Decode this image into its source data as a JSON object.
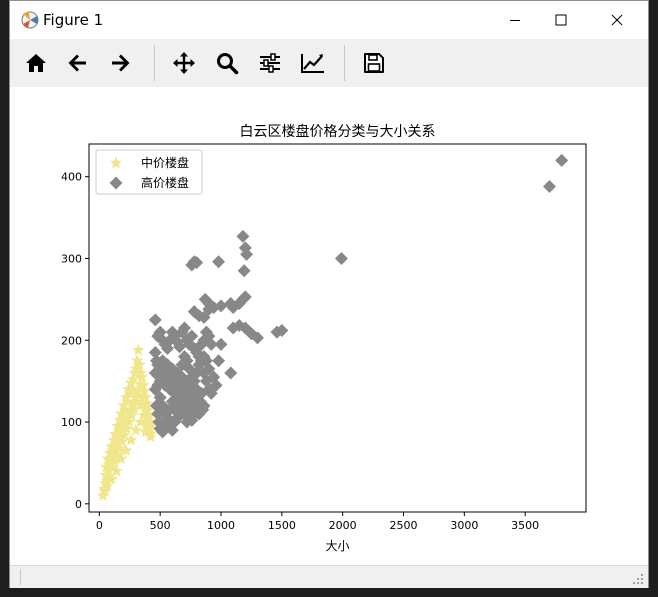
{
  "window": {
    "title": "Figure 1"
  },
  "toolbar": {
    "items": [
      {
        "icon": "home-icon"
      },
      {
        "icon": "back-arrow-icon"
      },
      {
        "icon": "forward-arrow-icon"
      },
      {
        "icon": "pan-move-icon"
      },
      {
        "icon": "zoom-magnifier-icon"
      },
      {
        "icon": "configure-subplots-icon"
      },
      {
        "icon": "edit-axis-icon"
      },
      {
        "icon": "save-floppy-icon"
      }
    ]
  },
  "colors": {
    "mid": "#f0e68c",
    "high": "#888888"
  },
  "chart_data": {
    "type": "scatter",
    "title": "白云区楼盘价格分类与大小关系",
    "xlabel": "大小",
    "ylabel": "",
    "xlim": [
      -85,
      4000
    ],
    "ylim": [
      -10,
      440
    ],
    "xticks": [
      0,
      500,
      1000,
      1500,
      2000,
      2500,
      3000,
      3500
    ],
    "yticks": [
      0,
      100,
      200,
      300,
      400
    ],
    "legend_position": "upper-left",
    "series": [
      {
        "name": "中价楼盘",
        "marker": "star",
        "color": "#f0e68c",
        "points": [
          [
            30,
            10
          ],
          [
            40,
            18
          ],
          [
            50,
            25
          ],
          [
            55,
            35
          ],
          [
            60,
            45
          ],
          [
            70,
            55
          ],
          [
            80,
            48
          ],
          [
            90,
            62
          ],
          [
            100,
            70
          ],
          [
            110,
            65
          ],
          [
            120,
            78
          ],
          [
            130,
            85
          ],
          [
            140,
            72
          ],
          [
            150,
            95
          ],
          [
            160,
            88
          ],
          [
            170,
            102
          ],
          [
            180,
            110
          ],
          [
            190,
            96
          ],
          [
            200,
            120
          ],
          [
            210,
            115
          ],
          [
            220,
            130
          ],
          [
            230,
            125
          ],
          [
            240,
            140
          ],
          [
            250,
            135
          ],
          [
            260,
            148
          ],
          [
            270,
            140
          ],
          [
            280,
            152
          ],
          [
            290,
            160
          ],
          [
            300,
            165
          ],
          [
            310,
            175
          ],
          [
            320,
            188
          ],
          [
            330,
            170
          ],
          [
            340,
            160
          ],
          [
            350,
            155
          ],
          [
            360,
            145
          ],
          [
            370,
            138
          ],
          [
            380,
            130
          ],
          [
            390,
            122
          ],
          [
            400,
            115
          ],
          [
            410,
            108
          ],
          [
            420,
            100
          ],
          [
            430,
            96
          ],
          [
            60,
            28
          ],
          [
            75,
            40
          ],
          [
            95,
            50
          ],
          [
            115,
            58
          ],
          [
            135,
            66
          ],
          [
            155,
            74
          ],
          [
            175,
            82
          ],
          [
            195,
            90
          ],
          [
            215,
            98
          ],
          [
            235,
            106
          ],
          [
            255,
            114
          ],
          [
            275,
            122
          ],
          [
            295,
            130
          ],
          [
            315,
            138
          ],
          [
            335,
            146
          ],
          [
            355,
            130
          ],
          [
            375,
            118
          ],
          [
            395,
            104
          ],
          [
            415,
            92
          ],
          [
            85,
            34
          ],
          [
            105,
            44
          ],
          [
            125,
            52
          ],
          [
            145,
            60
          ],
          [
            165,
            68
          ],
          [
            185,
            76
          ],
          [
            205,
            84
          ],
          [
            225,
            92
          ],
          [
            245,
            100
          ],
          [
            265,
            108
          ],
          [
            285,
            116
          ],
          [
            305,
            124
          ],
          [
            325,
            132
          ],
          [
            345,
            120
          ],
          [
            365,
            108
          ],
          [
            385,
            98
          ],
          [
            405,
            90
          ],
          [
            425,
            86
          ],
          [
            45,
            15
          ],
          [
            65,
            22
          ],
          [
            100,
            30
          ],
          [
            140,
            40
          ],
          [
            180,
            55
          ],
          [
            220,
            65
          ],
          [
            260,
            78
          ],
          [
            300,
            90
          ],
          [
            340,
            100
          ],
          [
            380,
            88
          ],
          [
            420,
            82
          ]
        ]
      },
      {
        "name": "高价楼盘",
        "marker": "diamond",
        "color": "#888888",
        "points": [
          [
            3800,
            420
          ],
          [
            3700,
            388
          ],
          [
            1990,
            300
          ],
          [
            1180,
            327
          ],
          [
            1200,
            313
          ],
          [
            1210,
            305
          ],
          [
            1190,
            285
          ],
          [
            980,
            296
          ],
          [
            1180,
            250
          ],
          [
            1200,
            253
          ],
          [
            1150,
            245
          ],
          [
            780,
            296
          ],
          [
            800,
            295
          ],
          [
            760,
            292
          ],
          [
            1080,
            245
          ],
          [
            1100,
            240
          ],
          [
            1000,
            242
          ],
          [
            870,
            250
          ],
          [
            900,
            245
          ],
          [
            780,
            235
          ],
          [
            820,
            230
          ],
          [
            860,
            228
          ],
          [
            900,
            238
          ],
          [
            940,
            240
          ],
          [
            1100,
            215
          ],
          [
            1150,
            218
          ],
          [
            1200,
            215
          ],
          [
            1250,
            208
          ],
          [
            1300,
            203
          ],
          [
            1460,
            210
          ],
          [
            1500,
            212
          ],
          [
            460,
            225
          ],
          [
            480,
            205
          ],
          [
            500,
            210
          ],
          [
            520,
            200
          ],
          [
            540,
            195
          ],
          [
            560,
            190
          ],
          [
            580,
            200
          ],
          [
            600,
            210
          ],
          [
            620,
            205
          ],
          [
            640,
            198
          ],
          [
            660,
            192
          ],
          [
            680,
            210
          ],
          [
            700,
            215
          ],
          [
            720,
            200
          ],
          [
            740,
            195
          ],
          [
            760,
            205
          ],
          [
            780,
            190
          ],
          [
            800,
            185
          ],
          [
            820,
            180
          ],
          [
            840,
            195
          ],
          [
            860,
            200
          ],
          [
            880,
            210
          ],
          [
            900,
            205
          ],
          [
            920,
            195
          ],
          [
            460,
            185
          ],
          [
            470,
            175
          ],
          [
            480,
            170
          ],
          [
            490,
            160
          ],
          [
            500,
            150
          ],
          [
            510,
            165
          ],
          [
            520,
            175
          ],
          [
            530,
            155
          ],
          [
            540,
            145
          ],
          [
            550,
            160
          ],
          [
            560,
            170
          ],
          [
            570,
            150
          ],
          [
            580,
            140
          ],
          [
            590,
            155
          ],
          [
            600,
            165
          ],
          [
            610,
            145
          ],
          [
            620,
            135
          ],
          [
            630,
            150
          ],
          [
            640,
            160
          ],
          [
            650,
            140
          ],
          [
            660,
            130
          ],
          [
            670,
            145
          ],
          [
            680,
            155
          ],
          [
            690,
            135
          ],
          [
            700,
            125
          ],
          [
            710,
            140
          ],
          [
            720,
            150
          ],
          [
            730,
            130
          ],
          [
            740,
            120
          ],
          [
            750,
            135
          ],
          [
            760,
            145
          ],
          [
            770,
            125
          ],
          [
            780,
            115
          ],
          [
            790,
            130
          ],
          [
            800,
            140
          ],
          [
            810,
            120
          ],
          [
            820,
            110
          ],
          [
            830,
            125
          ],
          [
            840,
            135
          ],
          [
            850,
            115
          ],
          [
            860,
            160
          ],
          [
            880,
            150
          ],
          [
            900,
            140
          ],
          [
            920,
            135
          ],
          [
            940,
            155
          ],
          [
            960,
            145
          ],
          [
            980,
            175
          ],
          [
            1000,
            195
          ],
          [
            1080,
            160
          ],
          [
            460,
            140
          ],
          [
            470,
            120
          ],
          [
            480,
            110
          ],
          [
            490,
            100
          ],
          [
            500,
            92
          ],
          [
            520,
            88
          ],
          [
            540,
            95
          ],
          [
            560,
            105
          ],
          [
            580,
            115
          ],
          [
            600,
            125
          ],
          [
            620,
            115
          ],
          [
            640,
            105
          ],
          [
            660,
            112
          ],
          [
            680,
            120
          ],
          [
            700,
            110
          ],
          [
            720,
            100
          ],
          [
            740,
            108
          ],
          [
            760,
            102
          ],
          [
            780,
            110
          ],
          [
            800,
            118
          ],
          [
            820,
            125
          ],
          [
            840,
            115
          ],
          [
            860,
            120
          ],
          [
            460,
            160
          ],
          [
            480,
            145
          ],
          [
            500,
            130
          ],
          [
            520,
            120
          ],
          [
            540,
            110
          ],
          [
            560,
            100
          ],
          [
            580,
            95
          ],
          [
            600,
            90
          ],
          [
            620,
            100
          ],
          [
            640,
            120
          ],
          [
            660,
            150
          ],
          [
            680,
            170
          ],
          [
            700,
            180
          ],
          [
            720,
            175
          ],
          [
            740,
            165
          ],
          [
            760,
            155
          ],
          [
            780,
            150
          ],
          [
            800,
            160
          ],
          [
            820,
            170
          ],
          [
            840,
            175
          ],
          [
            860,
            180
          ],
          [
            880,
            175
          ],
          [
            900,
            165
          ]
        ]
      }
    ]
  }
}
